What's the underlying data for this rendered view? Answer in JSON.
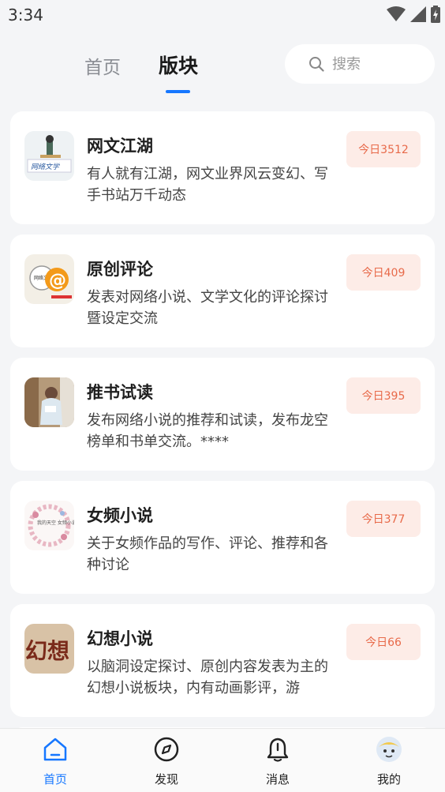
{
  "status": {
    "time": "3:34"
  },
  "tabs": {
    "home": "首页",
    "board": "版块"
  },
  "search": {
    "placeholder": "搜索"
  },
  "boards": [
    {
      "title": "网文江湖",
      "desc": "有人就有江湖，网文业界风云变幻、写手书站万千动态",
      "today": "今日3512",
      "thumb_text": "网络文学"
    },
    {
      "title": "原创评论",
      "desc": "发表对网络小说、文学文化的评论探讨暨设定交流",
      "today": "今日409",
      "thumb_text": "网络文学"
    },
    {
      "title": "推书试读",
      "desc": "发布网络小说的推荐和试读，发布龙空榜单和书单交流。****",
      "today": "今日395"
    },
    {
      "title": "女频小说",
      "desc": "关于女频作品的写作、评论、推荐和各种讨论",
      "today": "今日377",
      "thumb_text": "我的天空 女频小说"
    },
    {
      "title": "幻想小说",
      "desc": "以脑洞设定探讨、原创内容发表为主的幻想小说板块，内有动画影评，游",
      "today": "今日66",
      "thumb_text": "幻想"
    }
  ],
  "nav": {
    "home": "首页",
    "discover": "发现",
    "messages": "消息",
    "mine": "我的"
  },
  "colors": {
    "accent": "#1677ff",
    "badge_bg": "#fdece7",
    "badge_text": "#e86a4a"
  }
}
